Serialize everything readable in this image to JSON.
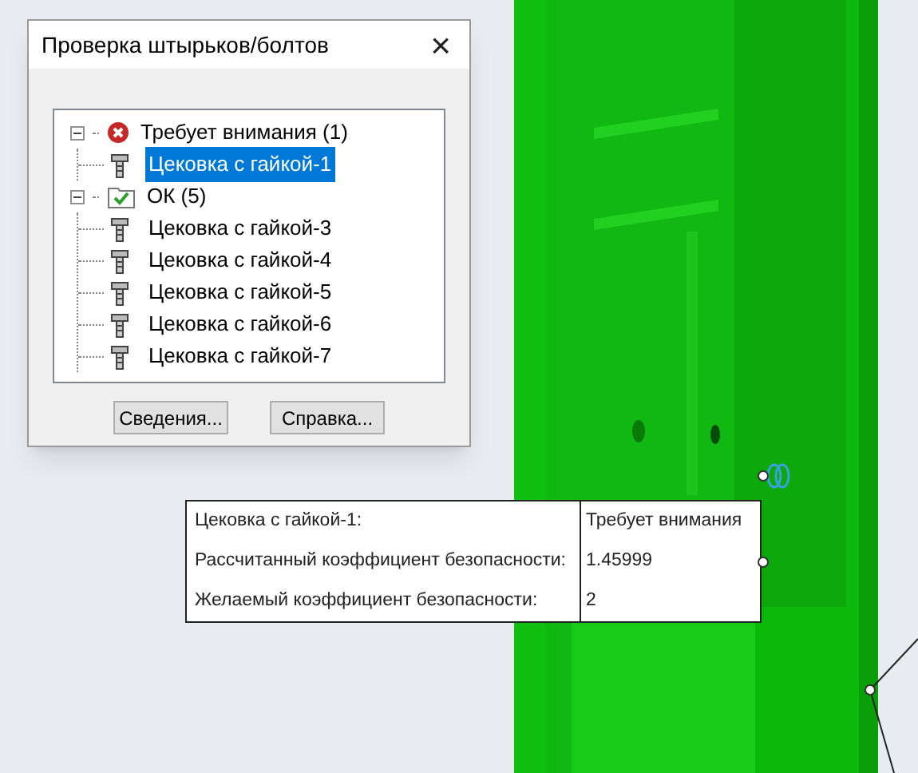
{
  "dialog": {
    "title": "Проверка штырьков/болтов",
    "close": "×"
  },
  "tree": [
    {
      "label": "Требует внимания (1)",
      "kind": "error",
      "expanded": true,
      "children": [
        {
          "label": "Цековка с гайкой-1",
          "selected": true
        }
      ]
    },
    {
      "label": "ОК (5)",
      "kind": "ok",
      "expanded": true,
      "children": [
        {
          "label": "Цековка с гайкой-3",
          "selected": false
        },
        {
          "label": "Цековка с гайкой-4",
          "selected": false
        },
        {
          "label": "Цековка с гайкой-5",
          "selected": false
        },
        {
          "label": "Цековка с гайкой-6",
          "selected": false
        },
        {
          "label": "Цековка с гайкой-7",
          "selected": false
        }
      ]
    }
  ],
  "buttons": [
    "Сведения...",
    "Справка..."
  ],
  "callout": [
    {
      "label": "Цековка с гайкой-1:",
      "value": "Требует внимания"
    },
    {
      "label": "Рассчитанный коэффициент безопасности:",
      "value": "1.45999"
    },
    {
      "label": "Желаемый коэффициент безопасности:",
      "value": "2"
    }
  ]
}
